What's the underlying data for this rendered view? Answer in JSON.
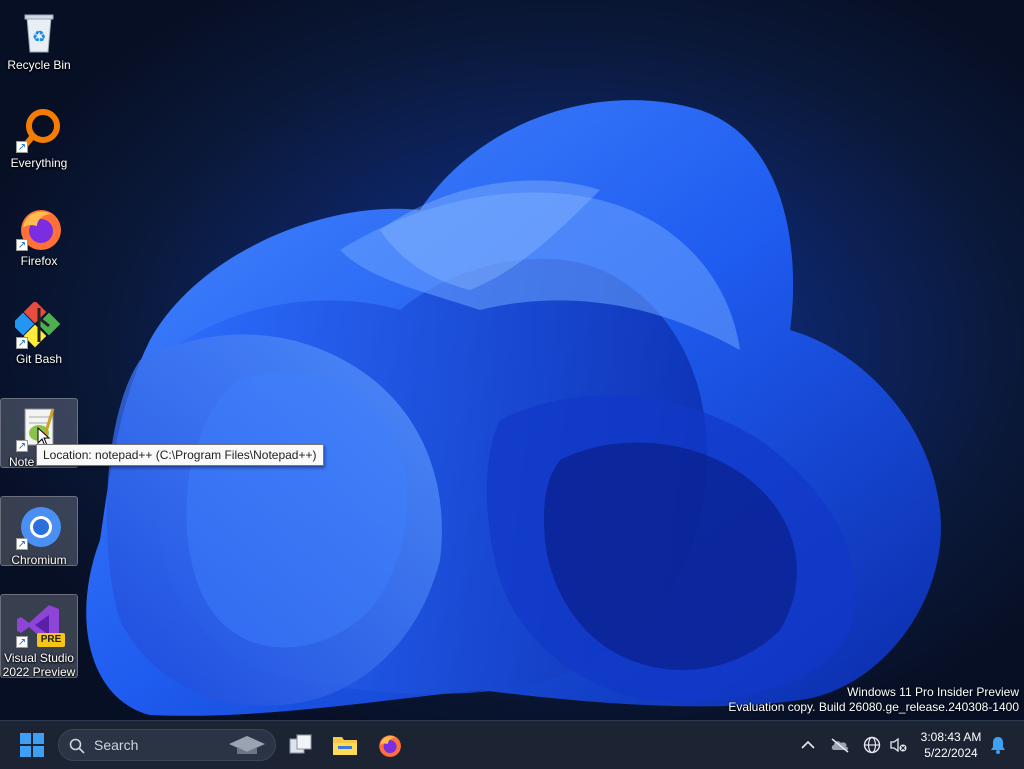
{
  "desktop": {
    "icons": [
      {
        "label": "Recycle Bin"
      },
      {
        "label": "Everything"
      },
      {
        "label": "Firefox"
      },
      {
        "label": "Git Bash"
      },
      {
        "label": "Note"
      },
      {
        "label": "Chromium"
      },
      {
        "label_line1": "Visual Studio",
        "label_line2": "2022 Preview",
        "badge": "PRE"
      }
    ],
    "tooltip": "Location: notepad++ (C:\\Program Files\\Notepad++)"
  },
  "watermark": {
    "line1": "Windows 11 Pro Insider Preview",
    "line2": "Evaluation copy. Build 26080.ge_release.240308-1400"
  },
  "taskbar": {
    "search_placeholder": "Search",
    "clock_time": "3:08:43 AM",
    "clock_date": "5/22/2024"
  },
  "colors": {
    "accent": "#1e6ff0",
    "taskbar_bg": "#1c2433"
  }
}
